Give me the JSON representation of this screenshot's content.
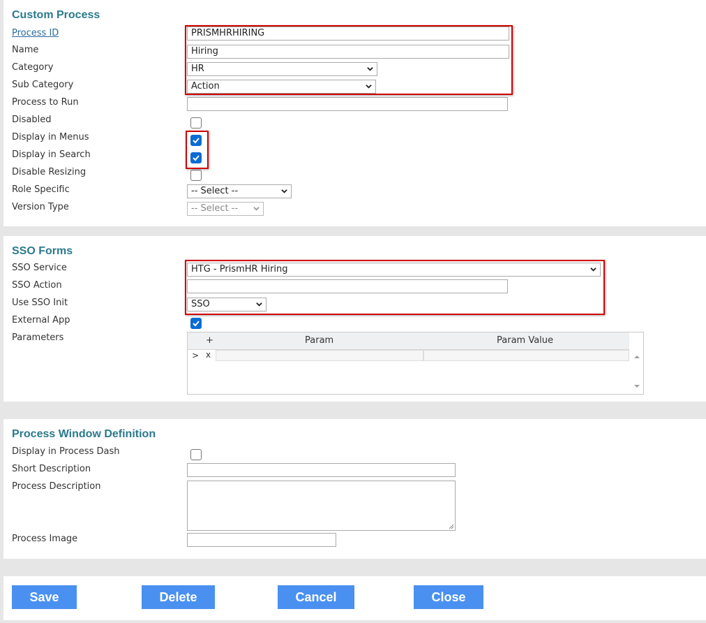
{
  "custom_process": {
    "title": "Custom Process",
    "process_id_label": "Process ID",
    "process_id_value": "PRISMHRHIRING",
    "name_label": "Name",
    "name_value": "Hiring",
    "category_label": "Category",
    "category_value": "HR",
    "sub_category_label": "Sub Category",
    "sub_category_value": "Action",
    "process_to_run_label": "Process to Run",
    "process_to_run_value": "",
    "disabled_label": "Disabled",
    "display_in_menus_label": "Display in Menus",
    "display_in_search_label": "Display in Search",
    "disable_resizing_label": "Disable Resizing",
    "role_specific_label": "Role Specific",
    "role_specific_value": "-- Select --",
    "version_type_label": "Version Type",
    "version_type_value": "-- Select --"
  },
  "sso_forms": {
    "title": "SSO Forms",
    "sso_service_label": "SSO Service",
    "sso_service_value": "HTG - PrismHR Hiring",
    "sso_action_label": "SSO Action",
    "sso_action_value": "",
    "use_sso_init_label": "Use SSO Init",
    "use_sso_init_value": "SSO",
    "external_app_label": "External App",
    "parameters_label": "Parameters",
    "grid": {
      "add": "+",
      "col_param": "Param",
      "col_param_value": "Param Value",
      "row_expand": ">",
      "row_delete": "x"
    }
  },
  "process_window": {
    "title": "Process Window Definition",
    "display_in_process_dash_label": "Display in Process Dash",
    "short_description_label": "Short Description",
    "process_description_label": "Process Description",
    "process_image_label": "Process Image"
  },
  "buttons": {
    "save": "Save",
    "delete": "Delete",
    "cancel": "Cancel",
    "close": "Close"
  },
  "colors": {
    "accent_title": "#2a7a8c",
    "button_bg": "#4a90f0",
    "highlight": "#d10000",
    "checkbox_checked": "#0b6cd4"
  }
}
